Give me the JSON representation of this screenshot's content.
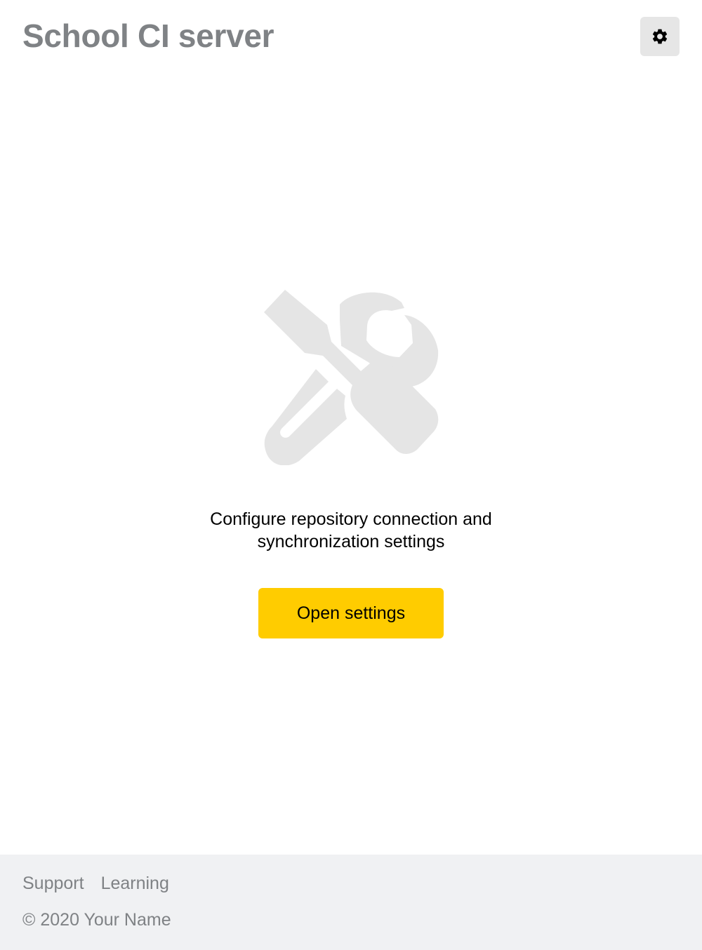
{
  "header": {
    "title": "School CI server",
    "settings_icon": "gear-icon"
  },
  "main": {
    "illustration_icon": "tools-icon",
    "message_line1": "Configure repository connection and",
    "message_line2": "synchronization settings",
    "open_settings_label": "Open settings",
    "accent_color": "#ffcc00"
  },
  "footer": {
    "links": [
      {
        "label": "Support"
      },
      {
        "label": "Learning"
      }
    ],
    "copyright": "© 2020 Your Name"
  }
}
